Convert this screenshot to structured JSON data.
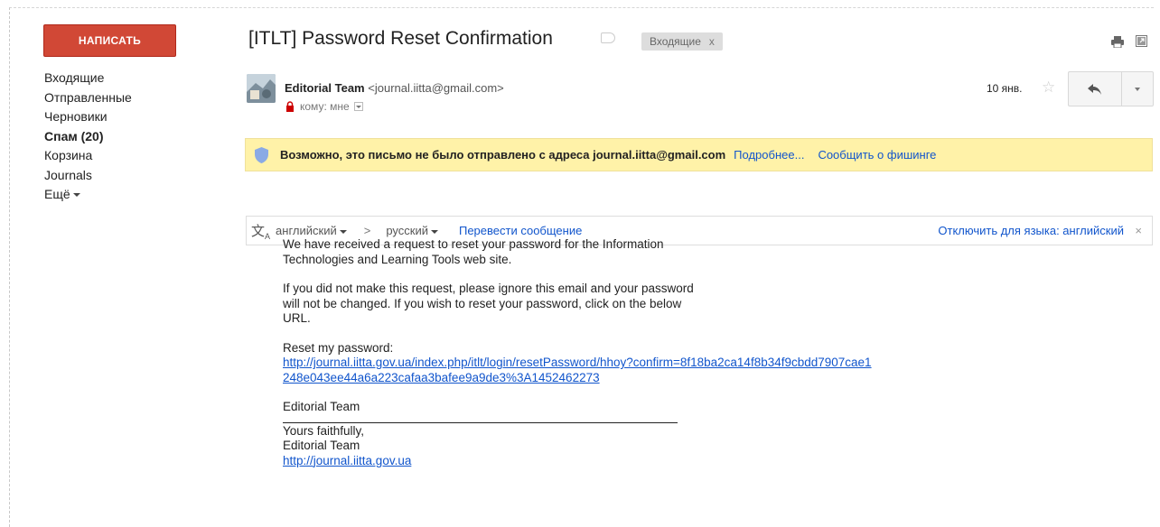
{
  "sidebar": {
    "compose_label": "НАПИСАТЬ",
    "items": [
      {
        "label": "Входящие"
      },
      {
        "label": "Отправленные"
      },
      {
        "label": "Черновики"
      },
      {
        "label": "Спам (20)"
      },
      {
        "label": "Корзина"
      },
      {
        "label": "Journals"
      },
      {
        "label": "Ещё"
      }
    ]
  },
  "message": {
    "subject": "[ITLT] Password Reset Confirmation",
    "label": "Входящие",
    "label_close": "x",
    "sender_name": "Editorial Team",
    "sender_email": "<journal.iitta@gmail.com>",
    "recipient": "кому: мне",
    "date": "10 янв."
  },
  "warning": {
    "text": "Возможно, это письмо не было отправлено с адреса journal.iitta@gmail.com",
    "more_link": "Подробнее...",
    "report_link": "Сообщить о фишинге"
  },
  "translate": {
    "source_lang": "английский",
    "arrow": ">",
    "target_lang": "русский",
    "action": "Перевести сообщение",
    "disable": "Отключить для языка: английский",
    "close": "×"
  },
  "body": {
    "para1_line1": "We have received a request to reset your password for the Information",
    "para1_line2": "Technologies and Learning Tools web site.",
    "para2_line1": "If you did not make this request, please ignore this email and your password",
    "para2_line2": "will not be changed. If you wish to reset your password, click on the below",
    "para2_line3": "URL.",
    "reset_label": "Reset my password:",
    "reset_link_line1": "http://journal.iitta.gov.ua/index.php/itlt/login/resetPassword/hhoy?confirm=8f18ba2ca14f8b34f9cbdd7907cae1",
    "reset_link_line2": "248e043ee44a6a223cafaa3bafee9a9de3%3A1452462273",
    "signoff": "Editorial Team",
    "sig_line1": "Yours faithfully,",
    "sig_line2": "Editorial Team",
    "sig_link": "http://journal.iitta.gov.ua"
  },
  "colors": {
    "compose": "#d14836",
    "link": "#1155cc",
    "warning_bg": "#fff2a8"
  },
  "icons": [
    "print-icon",
    "new-window-icon",
    "lock-icon",
    "shield-icon",
    "translate-icon",
    "reply-icon",
    "star-icon",
    "label-icon"
  ]
}
